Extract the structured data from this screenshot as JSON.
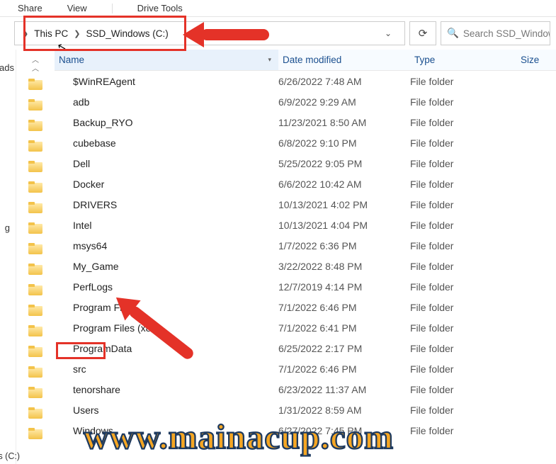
{
  "ribbon": {
    "share": "Share",
    "view": "View",
    "drive_tools": "Drive Tools"
  },
  "breadcrumb": {
    "seg1": "This PC",
    "seg2": "SSD_Windows (C:)"
  },
  "search": {
    "placeholder": "Search SSD_Windows (C:)"
  },
  "left": {
    "oads": "oads",
    "g": "g",
    "wsc": "ws (C:)"
  },
  "columns": {
    "name": "Name",
    "date": "Date modified",
    "type": "Type",
    "size": "Size"
  },
  "type_folder": "File folder",
  "rows": [
    {
      "name": "$WinREAgent",
      "date": "6/26/2022 7:48 AM"
    },
    {
      "name": "adb",
      "date": "6/9/2022 9:29 AM"
    },
    {
      "name": "Backup_RYO",
      "date": "11/23/2021 8:50 AM"
    },
    {
      "name": "cubebase",
      "date": "6/8/2022 9:10 PM"
    },
    {
      "name": "Dell",
      "date": "5/25/2022 9:05 PM"
    },
    {
      "name": "Docker",
      "date": "6/6/2022 10:42 AM"
    },
    {
      "name": "DRIVERS",
      "date": "10/13/2021 4:02 PM"
    },
    {
      "name": "Intel",
      "date": "10/13/2021 4:04 PM"
    },
    {
      "name": "msys64",
      "date": "1/7/2022 6:36 PM"
    },
    {
      "name": "My_Game",
      "date": "3/22/2022 8:48 PM"
    },
    {
      "name": "PerfLogs",
      "date": "12/7/2019 4:14 PM"
    },
    {
      "name": "Program Files",
      "date": "7/1/2022 6:46 PM"
    },
    {
      "name": "Program Files (x86)",
      "date": "7/1/2022 6:41 PM"
    },
    {
      "name": "ProgramData",
      "date": "6/25/2022 2:17 PM"
    },
    {
      "name": "src",
      "date": "7/1/2022 6:46 PM"
    },
    {
      "name": "tenorshare",
      "date": "6/23/2022 11:37 AM"
    },
    {
      "name": "Users",
      "date": "1/31/2022 8:59 AM"
    },
    {
      "name": "Windows",
      "date": "6/27/2022 7:45 PM"
    }
  ],
  "watermark": "www.mainacup.com"
}
